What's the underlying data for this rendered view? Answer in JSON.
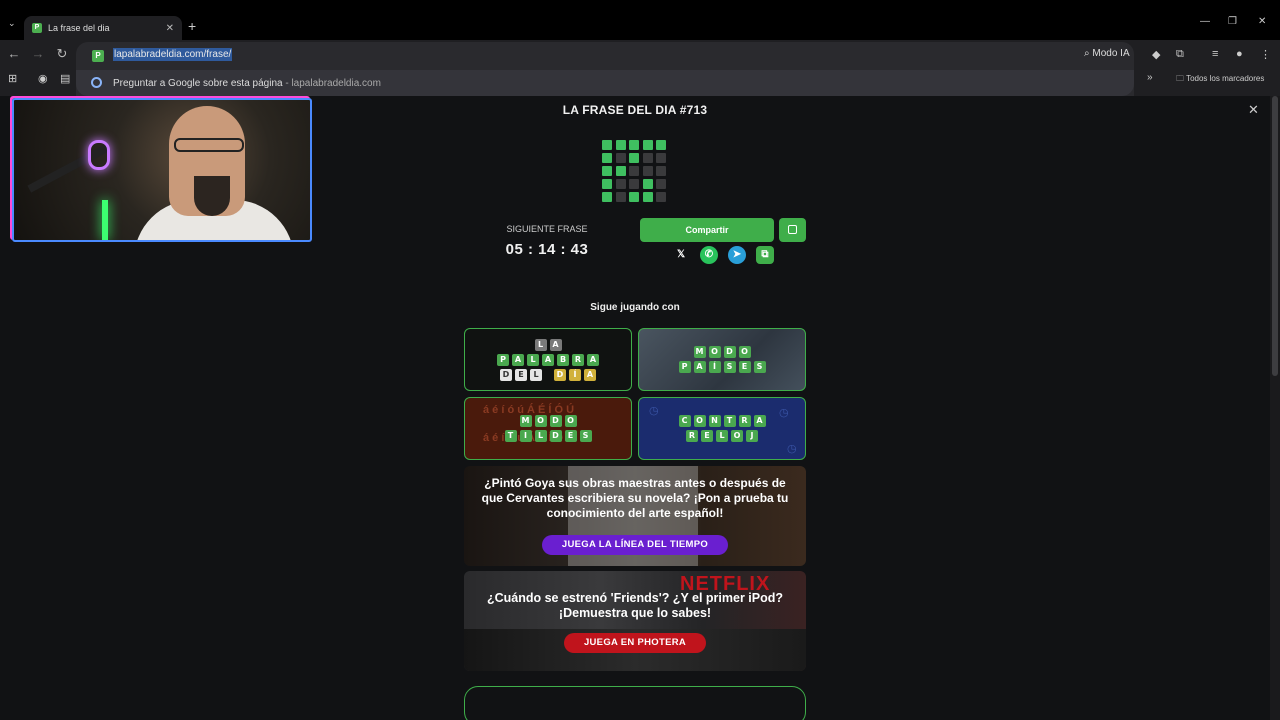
{
  "browser": {
    "tab_title": "La frase del dia",
    "url": "lapalabradeldia.com/frase/",
    "suggestion_text": "Preguntar a Google sobre esta página",
    "suggestion_sub": " - lapalabradeldia.com",
    "ai_mode_label": "Modo IA",
    "bookmarks_label": "Todos los marcadores"
  },
  "page": {
    "title": "LA FRASE DEL DIA #713",
    "next_phrase_label": "SIGUIENTE FRASE",
    "timer": "05 : 14 : 43",
    "share_label": "Compartir",
    "keep_playing_label": "Sigue jugando con",
    "result_grid": [
      [
        "g",
        "g",
        "g",
        "g",
        "g"
      ],
      [
        "g",
        "d",
        "g",
        "d",
        "d"
      ],
      [
        "g",
        "g",
        "d",
        "d",
        "d"
      ],
      [
        "g",
        "d",
        "d",
        "g",
        "d"
      ],
      [
        "g",
        "d",
        "g",
        "g",
        "d"
      ]
    ],
    "grid_colors": {
      "g": "#3fbf60",
      "d": "#3a3a3c"
    },
    "social": [
      "x-icon",
      "whatsapp-icon",
      "telegram-icon",
      "copy-icon"
    ]
  },
  "games": [
    {
      "name": "la-palabra-del-dia",
      "rows": [
        [
          "L",
          "A"
        ],
        [
          "P",
          "A",
          "L",
          "A",
          "B",
          "R",
          "A"
        ],
        [
          "D",
          "E",
          "L",
          " ",
          "D",
          "Í",
          "A"
        ]
      ]
    },
    {
      "name": "modo-paises",
      "rows": [
        [
          "M",
          "O",
          "D",
          "O"
        ],
        [
          "P",
          "A",
          "Í",
          "S",
          "E",
          "S"
        ]
      ]
    },
    {
      "name": "modo-tildes",
      "rows": [
        [
          "M",
          "O",
          "D",
          "O"
        ],
        [
          "T",
          "I",
          "L",
          "D",
          "E",
          "S"
        ]
      ],
      "background_text_top": "á é í ó ú Á É Í Ó Ú",
      "background_text_bottom": "á é í ó ú Á É Í Ó Ú"
    },
    {
      "name": "contra-reloj",
      "rows": [
        [
          "C",
          "O",
          "N",
          "T",
          "R",
          "A"
        ],
        [
          "R",
          "E",
          "L",
          "O",
          "J"
        ]
      ]
    }
  ],
  "promos": [
    {
      "text": "¿Pintó Goya sus obras maestras antes o después de que Cervantes escribiera su novela? ¡Pon a prueba tu conocimiento del arte español!",
      "button": "JUEGA LA LÍNEA DEL TIEMPO",
      "button_color": "#6a1fd0"
    },
    {
      "text": "¿Cuándo se estrenó 'Friends'? ¿Y el primer iPod? ¡Demuestra que lo sabes!",
      "button": "JUEGA EN PHOTERA",
      "button_color": "#c0141c",
      "bg_label": "NETFLIX"
    }
  ]
}
